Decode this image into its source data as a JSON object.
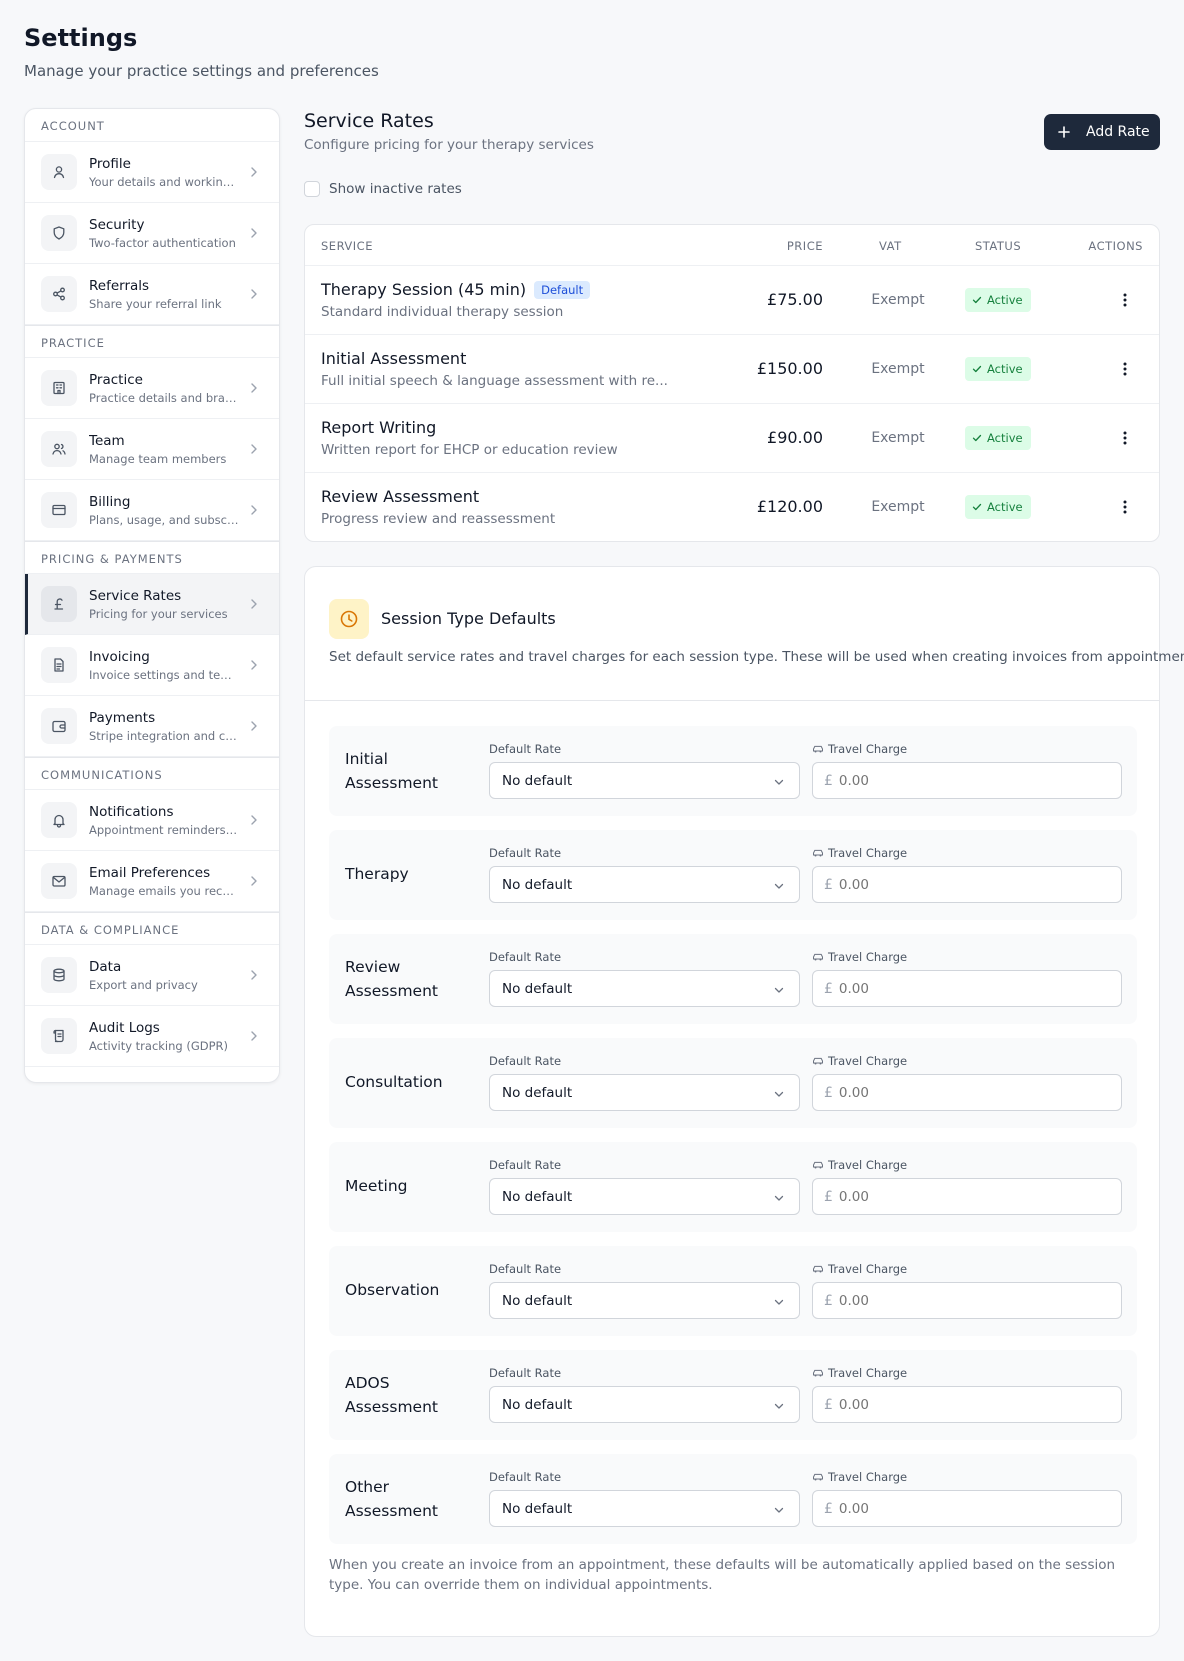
{
  "page": {
    "title": "Settings",
    "subtitle": "Manage your practice settings and preferences"
  },
  "sidebar": {
    "sections": [
      {
        "title": "ACCOUNT",
        "items": [
          {
            "label": "Profile",
            "desc": "Your details and working hours",
            "icon": "user-icon"
          },
          {
            "label": "Security",
            "desc": "Two-factor authentication",
            "icon": "shield-icon"
          },
          {
            "label": "Referrals",
            "desc": "Share your referral link",
            "icon": "share-icon"
          }
        ]
      },
      {
        "title": "PRACTICE",
        "items": [
          {
            "label": "Practice",
            "desc": "Practice details and branding",
            "icon": "building-icon"
          },
          {
            "label": "Team",
            "desc": "Manage team members",
            "icon": "users-icon"
          },
          {
            "label": "Billing",
            "desc": "Plans, usage, and subscription",
            "icon": "credit-card-icon"
          }
        ]
      },
      {
        "title": "PRICING & PAYMENTS",
        "items": [
          {
            "label": "Service Rates",
            "desc": "Pricing for your services",
            "icon": "pound-icon",
            "active": true
          },
          {
            "label": "Invoicing",
            "desc": "Invoice settings and templates",
            "icon": "document-icon"
          },
          {
            "label": "Payments",
            "desc": "Stripe integration and card payments",
            "icon": "wallet-icon"
          }
        ]
      },
      {
        "title": "COMMUNICATIONS",
        "items": [
          {
            "label": "Notifications",
            "desc": "Appointment reminders and alerts",
            "icon": "bell-icon"
          },
          {
            "label": "Email Preferences",
            "desc": "Manage emails you receive",
            "icon": "mail-icon"
          }
        ]
      },
      {
        "title": "DATA & COMPLIANCE",
        "items": [
          {
            "label": "Data",
            "desc": "Export and privacy",
            "icon": "database-icon"
          },
          {
            "label": "Audit Logs",
            "desc": "Activity tracking (GDPR)",
            "icon": "scroll-icon"
          }
        ]
      }
    ]
  },
  "rates": {
    "title": "Service Rates",
    "subtitle": "Configure pricing for your therapy services",
    "add_label": "Add Rate",
    "show_inactive_label": "Show inactive rates",
    "columns": {
      "service": "SERVICE",
      "price": "PRICE",
      "vat": "VAT",
      "status": "STATUS",
      "actions": "ACTIONS"
    },
    "rows": [
      {
        "name": "Therapy Session (45 min)",
        "badge": "Default",
        "desc": "Standard individual therapy session",
        "price": "£75.00",
        "vat": "Exempt",
        "status": "Active"
      },
      {
        "name": "Initial Assessment",
        "badge": "",
        "desc": "Full initial speech & language assessment with re...",
        "price": "£150.00",
        "vat": "Exempt",
        "status": "Active"
      },
      {
        "name": "Report Writing",
        "badge": "",
        "desc": "Written report for EHCP or education review",
        "price": "£90.00",
        "vat": "Exempt",
        "status": "Active"
      },
      {
        "name": "Review Assessment",
        "badge": "",
        "desc": "Progress review and reassessment",
        "price": "£120.00",
        "vat": "Exempt",
        "status": "Active"
      }
    ]
  },
  "session_defaults": {
    "title": "Session Type Defaults",
    "description": "Set default service rates and travel charges for each session type. These will be used when creating invoices from appointments.",
    "rate_label": "Default Rate",
    "travel_label": "Travel Charge",
    "currency": "£",
    "rows": [
      {
        "name": "Initial Assessment",
        "rate": "No default",
        "travel": "0.00"
      },
      {
        "name": "Therapy",
        "rate": "No default",
        "travel": "0.00"
      },
      {
        "name": "Review Assessment",
        "rate": "No default",
        "travel": "0.00"
      },
      {
        "name": "Consultation",
        "rate": "No default",
        "travel": "0.00"
      },
      {
        "name": "Meeting",
        "rate": "No default",
        "travel": "0.00"
      },
      {
        "name": "Observation",
        "rate": "No default",
        "travel": "0.00"
      },
      {
        "name": "ADOS Assessment",
        "rate": "No default",
        "travel": "0.00"
      },
      {
        "name": "Other Assessment",
        "rate": "No default",
        "travel": "0.00"
      }
    ],
    "footer": "When you create an invoice from an appointment, these defaults will be automatically applied based on the session type. You can override them on individual appointments."
  },
  "colors": {
    "primary": "#1e293b",
    "active_bg": "#dcfce7",
    "active_fg": "#15803d",
    "default_badge_bg": "#dbeafe",
    "clock_bg": "#fef3c7",
    "clock_fg": "#d97706"
  }
}
